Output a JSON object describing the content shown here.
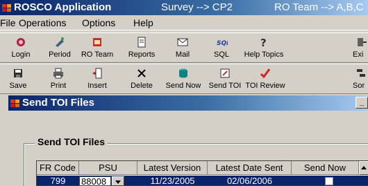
{
  "titlebar": {
    "app_title": "ROSCO Application",
    "survey": "Survey --> CP2",
    "team": "RO Team --> A,B,C"
  },
  "menu": [
    "File",
    "Operations",
    "Options",
    "Help"
  ],
  "toolbar_row1": [
    {
      "label": "Login",
      "icon": "login-icon"
    },
    {
      "label": "Period",
      "icon": "period-icon"
    },
    {
      "label": "RO Team",
      "icon": "team-icon"
    },
    {
      "label": "Reports",
      "icon": "reports-icon"
    },
    {
      "label": "Mail",
      "icon": "mail-icon"
    },
    {
      "label": "SQL",
      "icon": "sql-icon"
    },
    {
      "label": "Help Topics",
      "icon": "help-icon"
    },
    {
      "label": "Exi",
      "icon": "exit-icon"
    }
  ],
  "toolbar_row2": [
    {
      "label": "Save",
      "icon": "save-icon"
    },
    {
      "label": "Print",
      "icon": "print-icon"
    },
    {
      "label": "Insert",
      "icon": "insert-icon"
    },
    {
      "label": "Delete",
      "icon": "delete-icon"
    },
    {
      "label": "Send Now",
      "icon": "send-now-icon"
    },
    {
      "label": "Send TOI",
      "icon": "send-toi-icon"
    },
    {
      "label": "TOI Review",
      "icon": "toi-review-icon"
    },
    {
      "label": "Sor",
      "icon": "sort-icon"
    }
  ],
  "child_window": {
    "title": "Send TOI Files",
    "min_label": "_",
    "group_label": "Send TOI Files"
  },
  "grid": {
    "headers": [
      "FR Code",
      "PSU",
      "Latest Version",
      "Latest Date Sent",
      "Send Now"
    ],
    "rows": [
      {
        "fr_code": "799",
        "psu": "88008",
        "latest_version": "11/23/2005",
        "latest_date_sent": "02/06/2006",
        "send_now": false
      }
    ]
  },
  "colors": {
    "title_active": "#0a246a",
    "face": "#d4d0c8",
    "selection": "#0a246a"
  }
}
